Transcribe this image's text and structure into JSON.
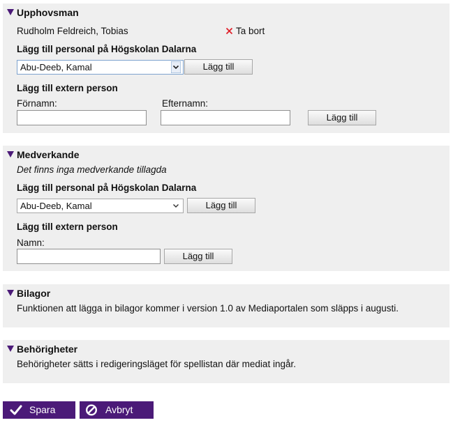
{
  "upphovsman": {
    "title": "Upphovsman",
    "person_name": "Rudholm Feldreich, Tobias",
    "remove_label": "Ta bort",
    "staff_heading": "Lägg till personal på Högskolan Dalarna",
    "staff_select_value": "Abu-Deeb, Kamal",
    "staff_add_label": "Lägg till",
    "external_heading": "Lägg till extern person",
    "firstname_label": "Förnamn:",
    "lastname_label": "Efternamn:",
    "firstname_value": "",
    "lastname_value": "",
    "external_add_label": "Lägg till"
  },
  "medverkande": {
    "title": "Medverkande",
    "empty_text": "Det finns inga medverkande tillagda",
    "staff_heading": "Lägg till personal på Högskolan Dalarna",
    "staff_select_value": "Abu-Deeb, Kamal",
    "staff_add_label": "Lägg till",
    "external_heading": "Lägg till extern person",
    "name_label": "Namn:",
    "name_value": "",
    "external_add_label": "Lägg till"
  },
  "bilagor": {
    "title": "Bilagor",
    "text": "Funktionen att lägga in bilagor kommer i version 1.0 av Mediaportalen som släpps i augusti."
  },
  "behorigheter": {
    "title": "Behörigheter",
    "text": "Behörigheter sätts i redigeringsläget för spellistan där mediat ingår."
  },
  "actions": {
    "save_label": "Spara",
    "cancel_label": "Avbryt"
  },
  "colors": {
    "accent": "#4b1a78",
    "panel_bg": "#efefef",
    "remove_x": "#e0202a"
  }
}
